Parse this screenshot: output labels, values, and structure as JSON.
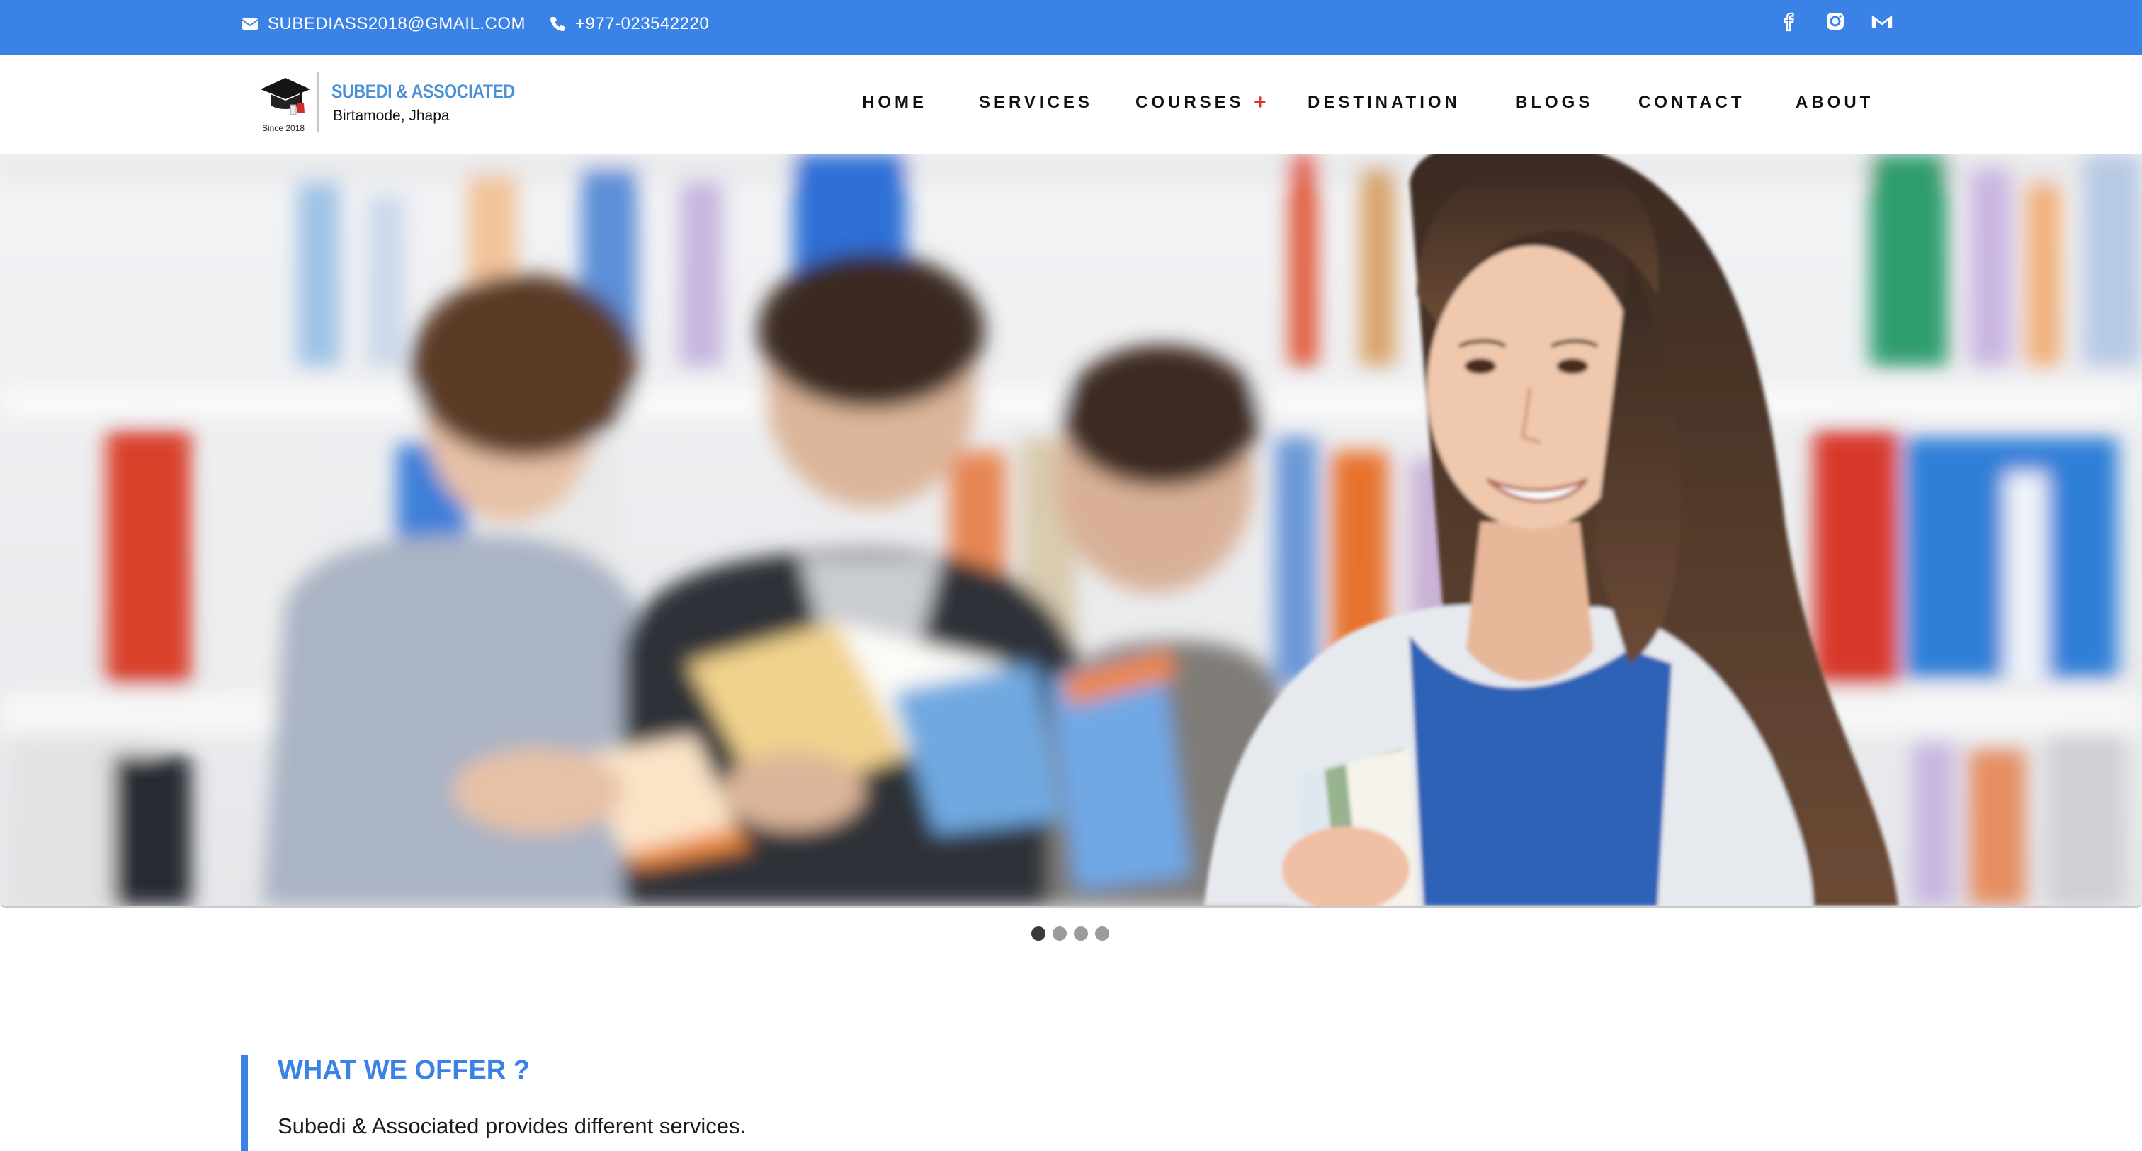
{
  "topbar": {
    "email": "SUBEDIASS2018@GMAIL.COM",
    "phone": "+977-023542220",
    "social": [
      "facebook-icon",
      "instagram-icon",
      "gmail-icon"
    ],
    "color": "#3b82e6"
  },
  "logo": {
    "brand": "SUBEDI & ASSOCIATED",
    "location": "Birtamode, Jhapa",
    "since": "Since 2018"
  },
  "nav": {
    "items": [
      "HOME",
      "SERVICES",
      "COURSES",
      "DESTINATION",
      "BLOGS",
      "CONTACT",
      "ABOUT"
    ],
    "courses_expand_icon": "plus-icon",
    "accent": "#e0322b"
  },
  "carousel": {
    "slides": 4,
    "active_index": 0
  },
  "offer": {
    "title": "WHAT WE OFFER ?",
    "subtitle": "Subedi & Associated provides different services."
  }
}
